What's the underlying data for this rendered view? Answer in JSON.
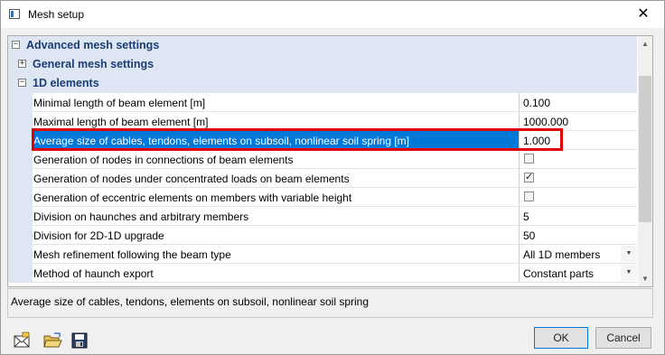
{
  "window": {
    "title": "Mesh setup",
    "close_glyph": "✕"
  },
  "grid": {
    "groups": {
      "advanced": {
        "label": "Advanced mesh settings",
        "state": "expanded",
        "glyph": "−"
      },
      "general": {
        "label": "General mesh settings",
        "state": "collapsed",
        "glyph": "+"
      },
      "oned": {
        "label": "1D elements",
        "state": "expanded",
        "glyph": "−"
      }
    },
    "properties": [
      {
        "name": "Minimal length of beam element [m]",
        "value": "0.100",
        "type": "text"
      },
      {
        "name": "Maximal length of beam element [m]",
        "value": "1000.000",
        "type": "text"
      },
      {
        "name": "Average size of cables, tendons, elements on subsoil, nonlinear soil spring [m]",
        "value": "1.000",
        "type": "text",
        "selected": true
      },
      {
        "name": "Generation of nodes in connections of beam elements",
        "value": false,
        "type": "checkbox"
      },
      {
        "name": "Generation of nodes under concentrated loads on beam elements",
        "value": true,
        "type": "checkbox"
      },
      {
        "name": "Generation of eccentric elements on members with variable height",
        "value": false,
        "type": "checkbox"
      },
      {
        "name": "Division on haunches and arbitrary members",
        "value": "5",
        "type": "text"
      },
      {
        "name": "Division for 2D-1D upgrade",
        "value": "50",
        "type": "text"
      },
      {
        "name": "Mesh refinement following the beam type",
        "value": "All 1D members",
        "type": "dropdown"
      },
      {
        "name": "Method of haunch export",
        "value": "Constant parts",
        "type": "dropdown"
      }
    ],
    "highlight_color": "#e00000",
    "selection_color": "#0078d7"
  },
  "description": {
    "text": "Average size of cables, tendons, elements on subsoil, nonlinear soil spring"
  },
  "footer": {
    "tools": [
      {
        "icon": "envelope-icon"
      },
      {
        "icon": "open-folder-icon"
      },
      {
        "icon": "save-disk-icon"
      }
    ],
    "ok_label": "OK",
    "cancel_label": "Cancel"
  }
}
